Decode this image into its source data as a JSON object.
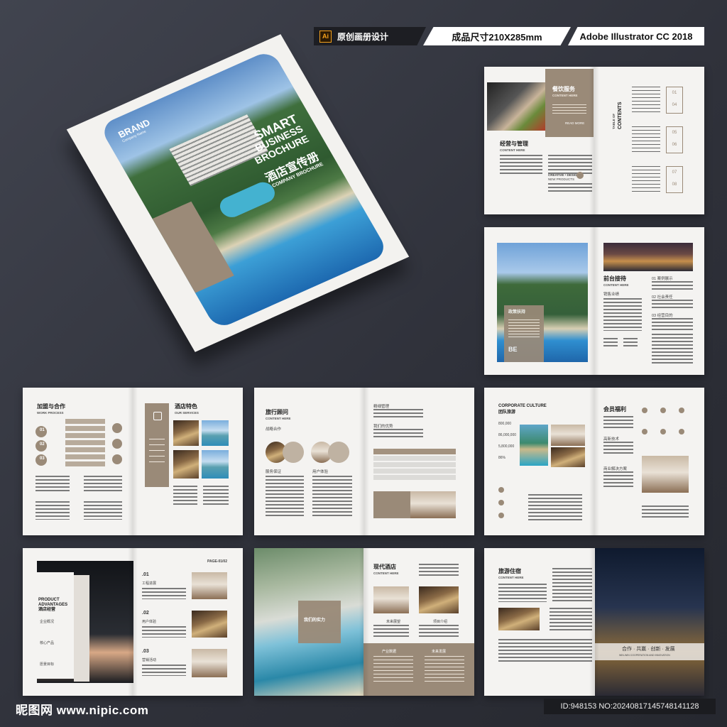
{
  "header": {
    "ai_label": "Ai",
    "badge1": "原创画册设计",
    "badge2": "成品尺寸210X285mm",
    "badge3": "Adobe Illustrator CC 2018"
  },
  "cover": {
    "brand": "BRAND",
    "brand_sub": "Company Name",
    "title1": "SMART",
    "title2": "BUSINESS",
    "title3": "BROCHURE",
    "cn_title": "酒店宣传册",
    "cn_sub": "COMPANY BROCHURE"
  },
  "spread1": {
    "dining": "餐饮服务",
    "content_here": "CONTENT HERE",
    "read_more": "READ MORE",
    "manage": "经营与管理",
    "manage_sub": "CONTENT HERE",
    "creative": "CREATIVE • DESIGN",
    "new_products": "NEW PRODUCTS",
    "toc1": "TABLE OF",
    "toc2": "CONTENTS",
    "nums": [
      "01",
      "04",
      "05",
      "06",
      "07",
      "08"
    ]
  },
  "spread2": {
    "left_title": "政策扶持",
    "be": "BE",
    "front": "前台接待",
    "front_sub": "CONTENT HERE",
    "sales": "销售业绩",
    "items": [
      "01 案例展示",
      "02 社会责任",
      "03 经营目的"
    ]
  },
  "spread3": {
    "title": "加盟与合作",
    "sub": "WORK PROCESS",
    "nums": [
      "01",
      "02",
      "03"
    ],
    "features": "酒店特色",
    "features_sub": "OUR SERVICES"
  },
  "spread4": {
    "title": "旅行顾问",
    "sub": "CONTENT HERE",
    "strategy": "战略合作",
    "service": "服务保证",
    "experience": "用户体验",
    "fine_manage": "精细管理",
    "advantage": "我们的优势"
  },
  "spread5": {
    "title": "CORPORATE CULTURE",
    "cn": "团队旅游",
    "stats": [
      "800,000",
      "86,000,000",
      "5,800,000",
      "86%"
    ],
    "welfare": "会员福利",
    "tech": "高新技术",
    "solution": "商业解决方案"
  },
  "spread6": {
    "title1": "PRODUCT",
    "title2": "ADVANTAGES",
    "cn": "酒店经营",
    "items": [
      "企业概况",
      "核心产品",
      "愿景目标"
    ],
    "page": "PAGE-01/02",
    "nums": [
      ".01",
      ".02",
      ".03"
    ],
    "labels": [
      "工程进展",
      "用户体验",
      "营销活动"
    ]
  },
  "spread7": {
    "title": "现代酒店",
    "sub": "CONTENT HERE",
    "center": "我们的实力",
    "future": "未来展望",
    "project": "项目介绍",
    "industry": "产业数据",
    "future2": "未来发展"
  },
  "spread8": {
    "title": "旅游住宿",
    "sub": "CONTENT HERE",
    "slogan": "合作 · 共赢 · 创新 · 发展",
    "slogan_sub": "WIN-WIN COOPERATION AND INNOVATION"
  },
  "footer": {
    "site": "昵图网 www.nipic.com",
    "id": "ID:948153 NO:20240817145748141128"
  },
  "colors": {
    "accent": "#9a8a78",
    "background": "#33353e"
  }
}
